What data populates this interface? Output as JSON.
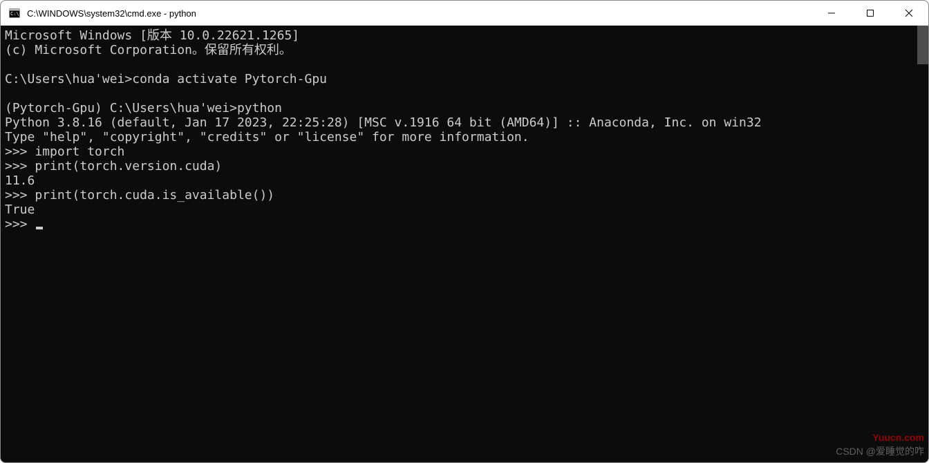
{
  "window": {
    "title": "C:\\WINDOWS\\system32\\cmd.exe - python"
  },
  "terminal": {
    "lines": [
      "Microsoft Windows [版本 10.0.22621.1265]",
      "(c) Microsoft Corporation。保留所有权利。",
      "",
      "C:\\Users\\hua'wei>conda activate Pytorch-Gpu",
      "",
      "(Pytorch-Gpu) C:\\Users\\hua'wei>python",
      "Python 3.8.16 (default, Jan 17 2023, 22:25:28) [MSC v.1916 64 bit (AMD64)] :: Anaconda, Inc. on win32",
      "Type \"help\", \"copyright\", \"credits\" or \"license\" for more information.",
      ">>> import torch",
      ">>> print(torch.version.cuda)",
      "11.6",
      ">>> print(torch.cuda.is_available())",
      "True",
      ">>> "
    ]
  },
  "watermarks": {
    "site": "Yuucn.com",
    "author": "CSDN @爱睡觉的咋"
  }
}
